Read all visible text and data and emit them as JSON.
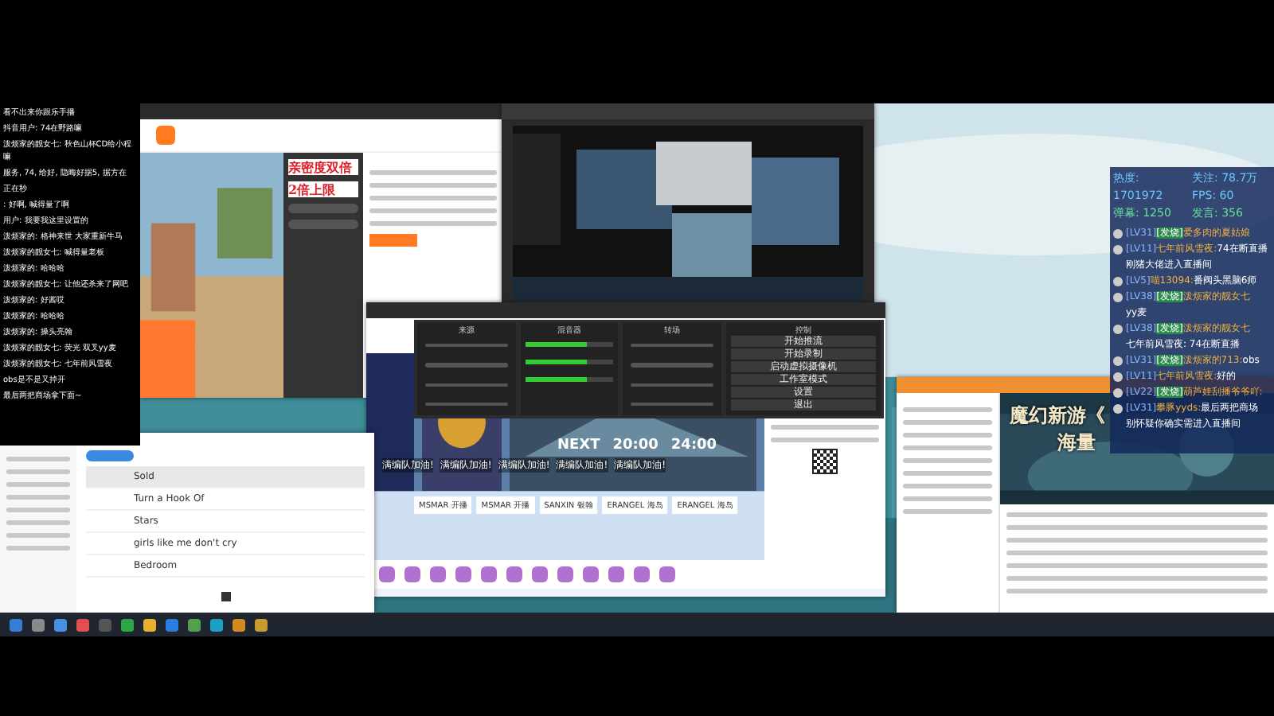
{
  "left_overlay": {
    "lines": [
      "看不出来你跟乐手播",
      "抖音用户: 74在野路嘛",
      "泼烦家的靓女七: 秋色山杯CD给小程嘛",
      "服务, 74, 给好, 隐晦好据5, 据方在",
      "正在秒",
      ": 好啊, 喊得量了啊",
      "用户: 我要我这里设置的",
      "泼烦家的: 格神来世 大家重新牛马",
      "泼烦家的靓女七: 喊得量老板",
      "泼烦家的: 哈哈哈",
      "泼烦家的靓女七: 让他还杀来了网吧",
      "泼烦家的: 好酱哎",
      "泼烦家的: 哈哈哈",
      "泼烦家的: 操头亮翰",
      "泼烦家的靓女七: 荧光 双叉yy麦",
      "泼烦家的靓女七: 七年前风雪夜",
      "obs是不是又掉开",
      "最后两把商场拿下面~"
    ]
  },
  "left_browser": {
    "promo_line1": "亲密度双倍",
    "promo_line2": "2倍上限"
  },
  "obs": {
    "sections": [
      "来源",
      "混音器",
      "转场",
      "控制"
    ],
    "controls": [
      "开始推流",
      "开始录制",
      "启动虚拟摄像机",
      "工作室模式",
      "设置",
      "退出"
    ]
  },
  "stream_page": {
    "banner": [
      "NEXT",
      "20:00",
      "24:00"
    ],
    "danmaku": [
      "满编队加油!",
      "满编队加油!",
      "满编队加油!",
      "满编队加油!",
      "满编队加油!"
    ],
    "teams": [
      {
        "name": "MSMAR",
        "tag": "开播"
      },
      {
        "name": "MSMAR",
        "tag": "开播"
      },
      {
        "name": "SANXIN",
        "tag": "银翰"
      },
      {
        "name": "ERANGEL",
        "tag": "海岛"
      },
      {
        "name": "ERANGEL",
        "tag": "海岛"
      }
    ]
  },
  "music": {
    "songs": [
      {
        "title": "Sold",
        "selected": true
      },
      {
        "title": "Turn a Hook Of",
        "selected": false
      },
      {
        "title": "Stars",
        "selected": false
      },
      {
        "title": "girls like me don't cry",
        "selected": false
      },
      {
        "title": "Bedroom",
        "selected": false
      }
    ]
  },
  "chat_app": {
    "banner_line1": "魔幻新游《",
    "banner_line2": "海量"
  },
  "right_overlay": {
    "heat_label": "热度:",
    "heat_value": "1701972",
    "follow": "关注: 78.7万",
    "fps": "FPS: 60",
    "danmaku": "弹幕: 1250",
    "speak": "发言: 356",
    "chat": [
      {
        "kind": "message",
        "level": "[LV31]",
        "badge": "[发烧]",
        "user": "爱多肉的夏姑娘"
      },
      {
        "kind": "message",
        "level": "[LV11]",
        "user": "七年前风雪夜:",
        "text": "74在断直播"
      },
      {
        "kind": "notice",
        "text": "刚猪大佬进入直播间"
      },
      {
        "kind": "message",
        "level": "[LV5]",
        "user": "喵13094:",
        "text": "番阀头黑脑6师"
      },
      {
        "kind": "message",
        "level": "[LV38]",
        "badge": "[发烧]",
        "user": "泼烦家的靓女七"
      },
      {
        "kind": "notice",
        "text": "yy麦"
      },
      {
        "kind": "message",
        "level": "[LV38]",
        "badge": "[发烧]",
        "user": "泼烦家的靓女七"
      },
      {
        "kind": "notice",
        "text": "七年前风雪夜: 74在断直播"
      },
      {
        "kind": "message",
        "level": "[LV31]",
        "badge": "[发烧]",
        "user": "泼烦家的713:",
        "text": "obs"
      },
      {
        "kind": "message",
        "level": "[LV11]",
        "user": "七年前风雪夜:",
        "text": "好的"
      },
      {
        "kind": "message",
        "level": "[LV22]",
        "badge": "[发烧]",
        "user": "葫芦娃刮播爷爷吖:"
      },
      {
        "kind": "message",
        "level": "[LV31]",
        "user": "攀豚yyds:",
        "text": "最后两把商场"
      },
      {
        "kind": "notice",
        "text": "别怀疑你确实需进入直播间"
      }
    ]
  }
}
